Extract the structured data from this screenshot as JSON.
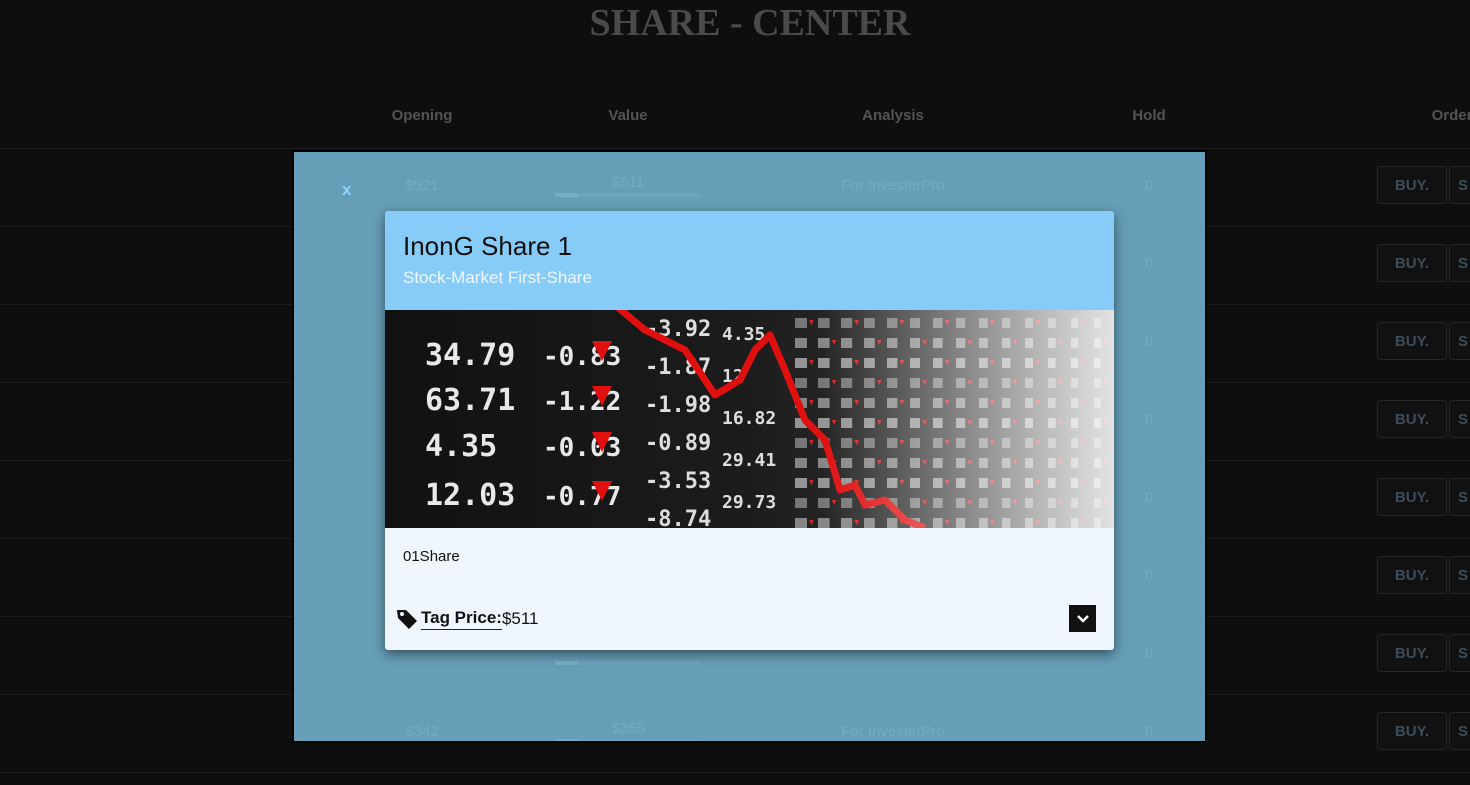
{
  "page": {
    "title": "SHARE - CENTER"
  },
  "table": {
    "headers": {
      "opening": "Opening",
      "value": "Value",
      "analysis": "Analysis",
      "hold": "Hold",
      "order": "Order"
    },
    "buy_label": "BUY.",
    "sell_label": "S",
    "rows": [
      {
        "opening": "$521",
        "value": "$511",
        "analysis": "For InvesterPro",
        "hold": "0",
        "value_fill": 0.16
      },
      {
        "opening": "",
        "value": "",
        "analysis": "",
        "hold": "0",
        "value_fill": 0.1
      },
      {
        "opening": "",
        "value": "",
        "analysis": "",
        "hold": "0",
        "value_fill": 0.1
      },
      {
        "opening": "",
        "value": "",
        "analysis": "",
        "hold": "0",
        "value_fill": 0.1
      },
      {
        "opening": "",
        "value": "",
        "analysis": "",
        "hold": "0",
        "value_fill": 0.1
      },
      {
        "opening": "",
        "value": "",
        "analysis": "",
        "hold": "0",
        "value_fill": 0.1
      },
      {
        "opening": "",
        "value": "",
        "analysis": "",
        "hold": "0",
        "value_fill": 0.16
      },
      {
        "opening": "$342",
        "value": "$355",
        "analysis": "For InvesterPro",
        "hold": "0",
        "value_fill": 0.16
      }
    ]
  },
  "modal": {
    "close_label": "x",
    "title": "InonG Share 1",
    "subtitle": "Stock-Market First-Share",
    "description": "01Share",
    "price_label": "Tag Price:",
    "price_value": "$511",
    "ticker_numbers": [
      "34.79",
      "63.71",
      "4.35",
      "12.03"
    ],
    "ticker_changes": [
      "-0.83",
      "-1.22",
      "-0.03",
      "-0.77"
    ],
    "ticker_pct": [
      "-3.92",
      "-1.87",
      "-1.98",
      "-0.89",
      "-3.53",
      "-8.74"
    ],
    "ticker_misc": [
      "4.35",
      "12",
      "16.82",
      "29.41",
      "29.73"
    ]
  },
  "colors": {
    "overlay": "#7dc3e2",
    "card_header": "#87cbf9",
    "card_body": "#f0f6fd",
    "accent_red": "#e01010"
  },
  "icons": {
    "close": "close-icon",
    "tag": "tag-icon",
    "expand": "chevron-down-icon"
  }
}
